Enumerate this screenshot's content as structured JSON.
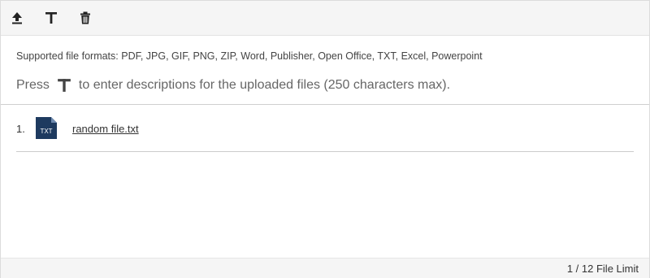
{
  "toolbar": {
    "buttons": [
      {
        "icon": "upload-icon"
      },
      {
        "icon": "text-description-icon"
      },
      {
        "icon": "trash-icon"
      }
    ]
  },
  "info": {
    "supported_formats": "Supported file formats: PDF, JPG, GIF, PNG, ZIP, Word, Publisher, Open Office, TXT, Excel, Powerpoint",
    "press_prefix": "Press",
    "press_suffix": "to enter descriptions for the uploaded files (250 characters max).",
    "press_icon": "text-description-icon"
  },
  "files": [
    {
      "index": "1.",
      "type_label": "TXT",
      "name": "random file.txt"
    }
  ],
  "footer": {
    "limit": "1 / 12 File Limit"
  },
  "colors": {
    "toolbar_bg": "#f5f5f5",
    "file_icon": "#1e3a5f",
    "text": "#333333"
  }
}
